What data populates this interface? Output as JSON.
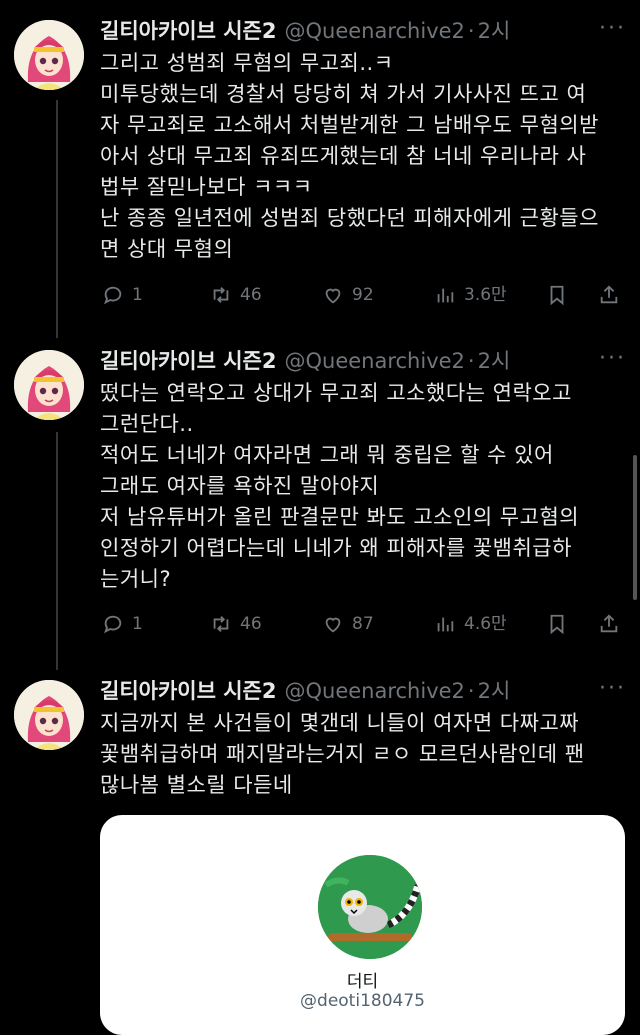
{
  "tweets": [
    {
      "name": "길티아카이브 시즌2",
      "handle": "@Queenarchive2",
      "time": "2시",
      "text": "그리고 성범죄 무혐의 무고죄..ㅋ\n미투당했는데 경찰서 당당히 쳐 가서 기사사진 뜨고 여\n자 무고죄로 고소해서 처벌받게한 그 남배우도 무혐의받\n아서 상대 무고죄 유죄뜨게했는데 참 너네 우리나라 사\n법부 잘믿나보다 ㅋㅋㅋ\n난 종종 일년전에 성범죄 당했다던 피해자에게 근황들으\n면 상대 무혐의",
      "replies": "1",
      "retweets": "46",
      "likes": "92",
      "views": "3.6만"
    },
    {
      "name": "길티아카이브 시즌2",
      "handle": "@Queenarchive2",
      "time": "2시",
      "text": "떴다는 연락오고 상대가 무고죄 고소했다는 연락오고\n그런단다..\n적어도 너네가 여자라면 그래 뭐 중립은 할 수 있어\n그래도 여자를 욕하진 말아야지\n저 남유튜버가 올린 판결문만 봐도 고소인의 무고혐의\n인정하기 어렵다는데 니네가 왜 피해자를 꽃뱀취급하\n는거니?",
      "replies": "1",
      "retweets": "46",
      "likes": "87",
      "views": "4.6만"
    },
    {
      "name": "길티아카이브 시즌2",
      "handle": "@Queenarchive2",
      "time": "2시",
      "text": "지금까지 본 사건들이 몇갠데 니들이 여자면 다짜고짜\n꽃뱀취급하며 패지말라는거지 ㄹㅇ 모르던사람인데 팬\n많나봄 별소릴 다듣네"
    }
  ],
  "card": {
    "name": "더티",
    "handle": "@deoti180475"
  },
  "icons": {
    "reply": "reply-icon",
    "retweet": "retweet-icon",
    "like": "heart-icon",
    "views": "views-icon",
    "bookmark": "bookmark-icon",
    "share": "share-icon",
    "more": "more-icon"
  },
  "colors": {
    "background": "#000000",
    "text": "#e7e9ea",
    "muted": "#71767b"
  }
}
